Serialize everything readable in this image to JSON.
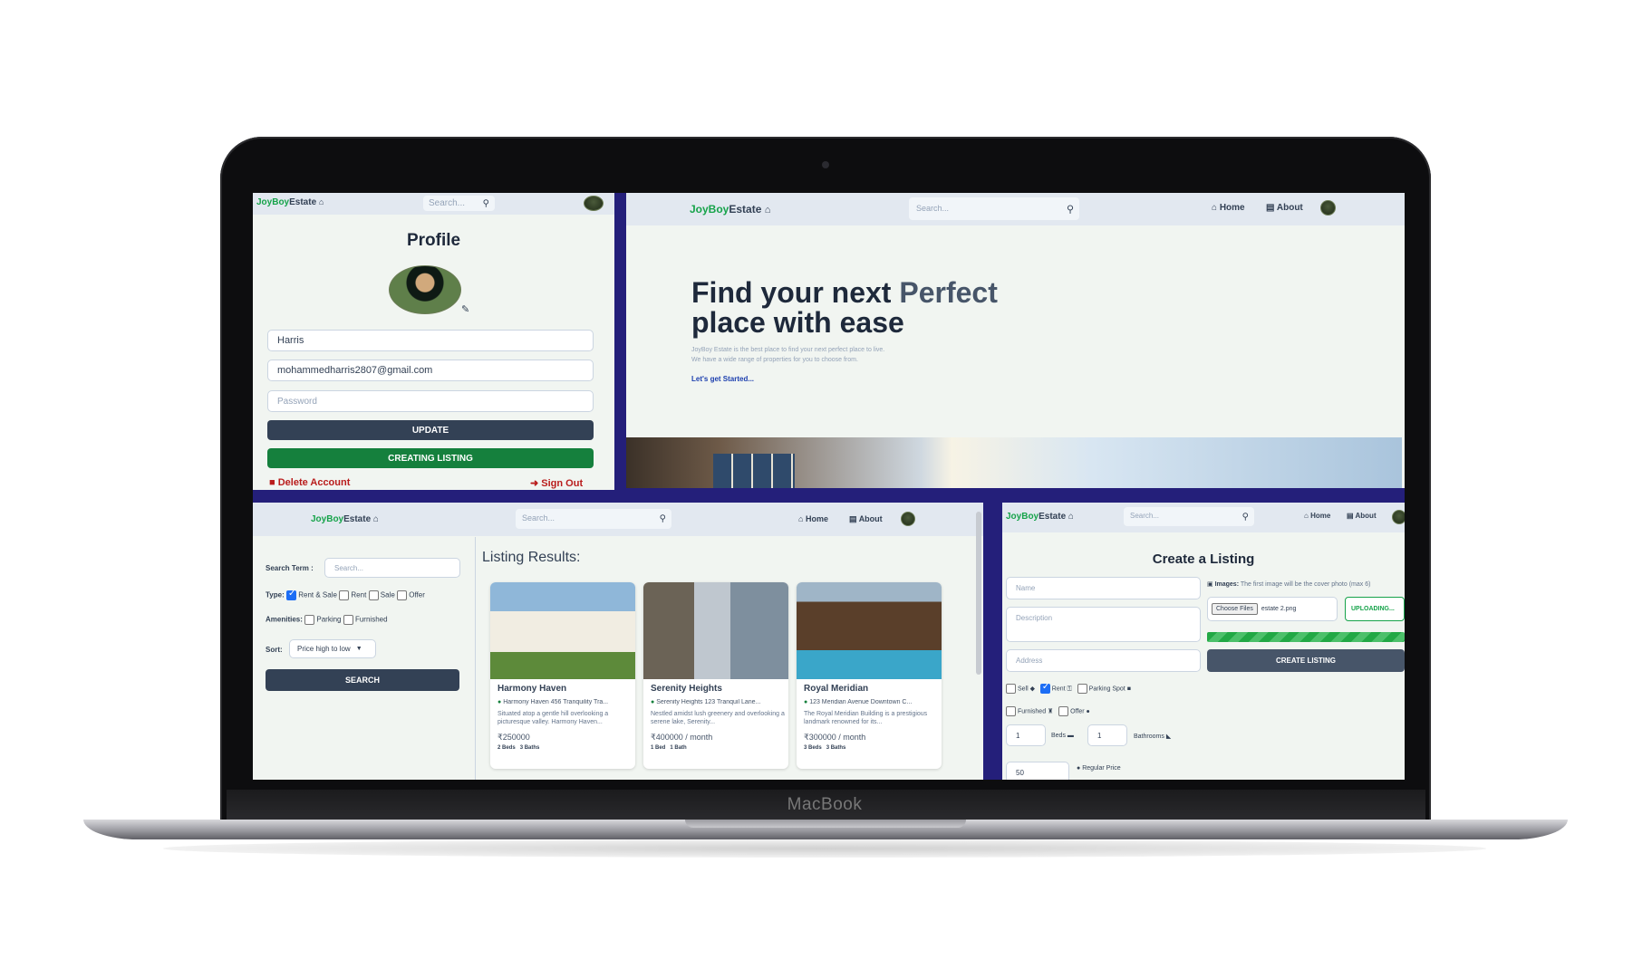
{
  "device": {
    "brand": "MacBook"
  },
  "profile_panel": {
    "logo_green": "JoyBoy",
    "logo_dark": "Estate",
    "search_placeholder": "Search...",
    "title": "Profile",
    "username": "Harris",
    "email": "mohammedharris2807@gmail.com",
    "password_placeholder": "Password",
    "update_label": "UPDATE",
    "create_listing_label": "CREATING LISTING",
    "delete_label": "Delete Account",
    "signout_label": "Sign Out"
  },
  "home_panel": {
    "logo_green": "JoyBoy",
    "logo_dark": "Estate",
    "search_placeholder": "Search...",
    "nav_home": "Home",
    "nav_about": "About",
    "hero_line1_a": "Find your next ",
    "hero_line1_b": "Perfect",
    "hero_line2": "place with ease",
    "sub_line1": "JoyBoy Estate is the best place to find your next perfect place to live.",
    "sub_line2": "We have a wide range of properties for you to choose from.",
    "cta": "Let's get Started..."
  },
  "search_panel": {
    "logo_green": "JoyBoy",
    "logo_dark": "Estate",
    "search_placeholder": "Search...",
    "nav_home": "Home",
    "nav_about": "About",
    "term_label": "Search Term :",
    "term_placeholder": "Search...",
    "type_label": "Type:",
    "types": [
      "Rent & Sale",
      "Rent",
      "Sale",
      "Offer"
    ],
    "amenities_label": "Amenities:",
    "amenities": [
      "Parking",
      "Furnished"
    ],
    "sort_label": "Sort:",
    "sort_value": "Price high to low",
    "search_button": "SEARCH",
    "results_title": "Listing Results:",
    "listings": [
      {
        "title": "Harmony Haven",
        "address": "Harmony Haven 456 Tranquility Tra...",
        "desc": "Situated atop a gentle hill overlooking a picturesque valley. Harmony Haven...",
        "price": "₹250000",
        "beds": "2 Beds",
        "baths": "3 Baths"
      },
      {
        "title": "Serenity Heights",
        "address": "Serenity Heights 123 Tranquil Lane...",
        "desc": "Nestled amidst lush greenery and overlooking a serene lake, Serenity...",
        "price": "₹400000 / month",
        "beds": "1 Bed",
        "baths": "1 Bath"
      },
      {
        "title": "Royal Meridian",
        "address": "123 Meridian Avenue Downtown C...",
        "desc": "The Royal Meridian Building is a prestigious landmark renowned for its...",
        "price": "₹300000 / month",
        "beds": "3 Beds",
        "baths": "3 Baths"
      }
    ]
  },
  "create_panel": {
    "logo_green": "JoyBoy",
    "logo_dark": "Estate",
    "search_placeholder": "Search...",
    "nav_home": "Home",
    "nav_about": "About",
    "title": "Create a Listing",
    "name_placeholder": "Name",
    "description_placeholder": "Description",
    "address_placeholder": "Address",
    "images_label": "Images:",
    "images_note": "The first image will be the cover photo (max 6)",
    "choose_files": "Choose Files",
    "file_name": "estate 2.png",
    "uploading": "UPLOADING...",
    "upload_progress": 1.0,
    "create_button": "CREATE LISTING",
    "options": [
      "Sell",
      "Rent",
      "Parking Spot",
      "Furnished",
      "Offer"
    ],
    "beds_value": "1",
    "beds_label": "Beds",
    "baths_value": "1",
    "baths_label": "Bathrooms",
    "price_value": "50",
    "regular_price_label": "Regular Price"
  },
  "colors": {
    "green": "#16a34a",
    "slate": "#334155",
    "header": "#e2e8f0",
    "red": "#b91c1c",
    "divider": "#241f7a"
  }
}
